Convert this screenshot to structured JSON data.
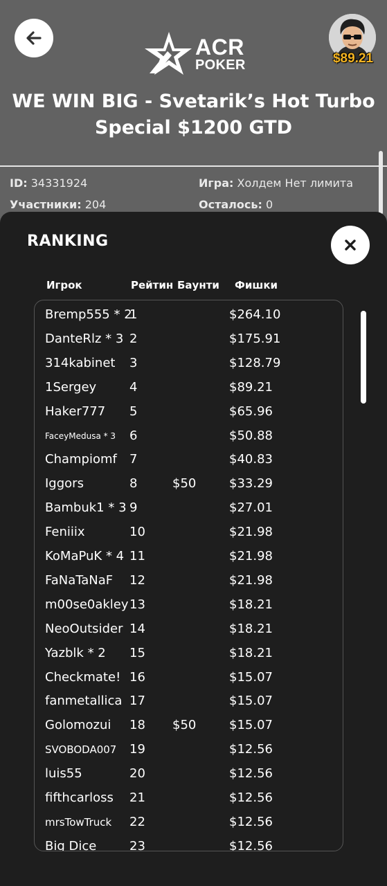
{
  "header": {
    "logo": {
      "line1": "ACR",
      "line2": "POKER"
    },
    "balance": "$89.21",
    "title_line1": "WE WIN BIG - Svetarik’s Hot Turbo",
    "title_line2": "Special $1200 GTD"
  },
  "info": {
    "id_label": "ID:",
    "id_value": "34331924",
    "participants_label": "Участники:",
    "participants_value": "204",
    "game_label": "Игра:",
    "game_value": "Холдем Нет лимита",
    "remaining_label": "Осталось:",
    "remaining_value": "0"
  },
  "ranking": {
    "title": "RANKING",
    "columns": {
      "player": "Игрок",
      "rank": "Рейтин",
      "bounty": "Баунти",
      "chips": "Фишки"
    },
    "rows": [
      {
        "player": "Bremp555 * 2",
        "rank": "1",
        "bounty": "",
        "chips": "$264.10"
      },
      {
        "player": "DanteRlz * 3",
        "rank": "2",
        "bounty": "",
        "chips": "$175.91"
      },
      {
        "player": "314kabinet",
        "rank": "3",
        "bounty": "",
        "chips": "$128.79"
      },
      {
        "player": "1Sergey",
        "rank": "4",
        "bounty": "",
        "chips": "$89.21"
      },
      {
        "player": "Haker777",
        "rank": "5",
        "bounty": "",
        "chips": "$65.96"
      },
      {
        "player": "FaceyMedusa * 3",
        "rank": "6",
        "bounty": "",
        "chips": "$50.88"
      },
      {
        "player": "Champiomf",
        "rank": "7",
        "bounty": "",
        "chips": "$40.83"
      },
      {
        "player": "Iggors",
        "rank": "8",
        "bounty": "$50",
        "chips": "$33.29"
      },
      {
        "player": "Bambuk1 * 3",
        "rank": "9",
        "bounty": "",
        "chips": "$27.01"
      },
      {
        "player": "Feniiix",
        "rank": "10",
        "bounty": "",
        "chips": "$21.98"
      },
      {
        "player": "KoMaPuK * 4",
        "rank": "11",
        "bounty": "",
        "chips": "$21.98"
      },
      {
        "player": "FaNaTaNaF",
        "rank": "12",
        "bounty": "",
        "chips": "$21.98"
      },
      {
        "player": "m00se0akley",
        "rank": "13",
        "bounty": "",
        "chips": "$18.21"
      },
      {
        "player": "NeoOutsider",
        "rank": "14",
        "bounty": "",
        "chips": "$18.21"
      },
      {
        "player": "Yazblk * 2",
        "rank": "15",
        "bounty": "",
        "chips": "$18.21"
      },
      {
        "player": "Checkmate!",
        "rank": "16",
        "bounty": "",
        "chips": "$15.07"
      },
      {
        "player": "fanmetallica",
        "rank": "17",
        "bounty": "",
        "chips": "$15.07"
      },
      {
        "player": "Golomozui",
        "rank": "18",
        "bounty": "$50",
        "chips": "$15.07"
      },
      {
        "player": "SVOBODA007",
        "rank": "19",
        "bounty": "",
        "chips": "$12.56"
      },
      {
        "player": "luis55",
        "rank": "20",
        "bounty": "",
        "chips": "$12.56"
      },
      {
        "player": "fifthcarloss",
        "rank": "21",
        "bounty": "",
        "chips": "$12.56"
      },
      {
        "player": "mrsTowTruck",
        "rank": "22",
        "bounty": "",
        "chips": "$12.56"
      },
      {
        "player": "Big Dice",
        "rank": "23",
        "bounty": "",
        "chips": "$12.56"
      }
    ]
  },
  "icons": {
    "back": "arrow-left-icon",
    "close": "close-icon",
    "logo": "acr-star-logo-icon",
    "avatar": "player-avatar-icon"
  },
  "colors": {
    "header_bg": "#626262",
    "modal_bg": "#1e1e1e",
    "balance": "#f3b321"
  }
}
